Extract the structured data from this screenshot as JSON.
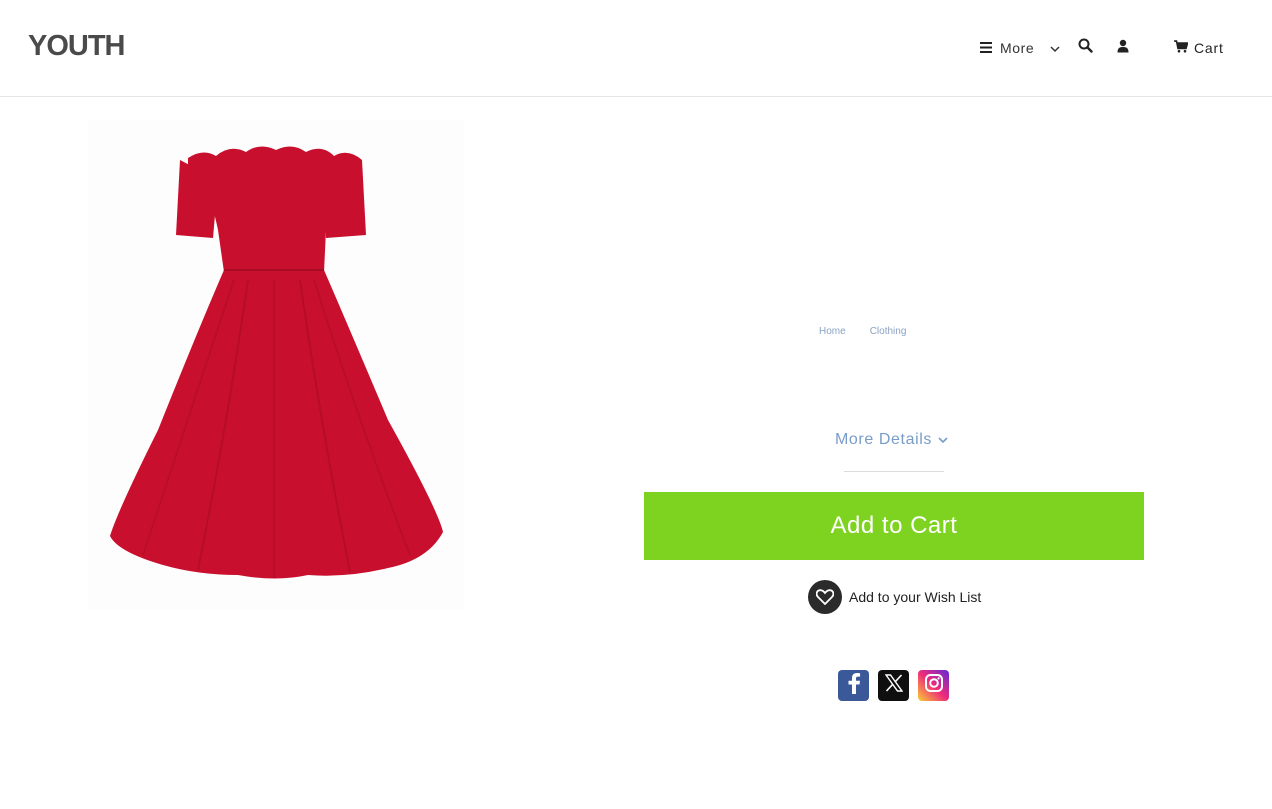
{
  "header": {
    "logo": "YOUTH",
    "nav": {
      "more_label": "More",
      "cart_label": "Cart"
    },
    "icons": {
      "menu": "hamburger-icon",
      "more_dropdown": "chevron-down-icon",
      "search": "search-icon",
      "account": "user-icon",
      "cart": "cart-icon"
    }
  },
  "product": {
    "image_alt": "red off-shoulder dress",
    "image_color": "#c8102e"
  },
  "breadcrumb": {
    "items": [
      "Home",
      "Clothing"
    ]
  },
  "details": {
    "more_details_label": "More Details"
  },
  "actions": {
    "add_to_cart_label": "Add to Cart",
    "add_to_cart_color": "#7ed321",
    "wishlist_label": "Add to your Wish List"
  },
  "social": {
    "facebook": "facebook-icon",
    "x": "x-icon",
    "instagram": "instagram-icon"
  }
}
